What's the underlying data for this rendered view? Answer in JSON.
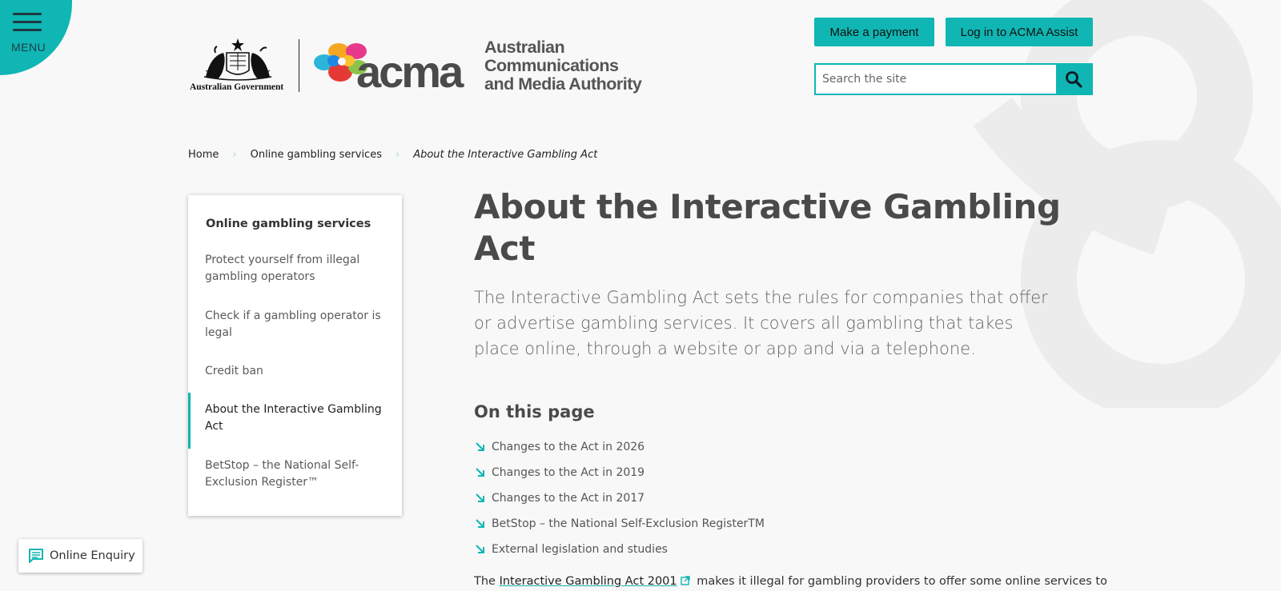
{
  "header": {
    "menu_label": "MENU",
    "gov_label": "Australian Government",
    "acma_word": "acma",
    "acma_fullname_lines": [
      "Australian",
      "Communications",
      "and Media Authority"
    ],
    "payment_label": "Make a payment",
    "login_label": "Log in to ACMA Assist",
    "search_placeholder": "Search the site"
  },
  "breadcrumb": {
    "items": [
      "Home",
      "Online gambling services",
      "About the Interactive Gambling Act"
    ]
  },
  "sidebar": {
    "title": "Online gambling services",
    "items": [
      {
        "label": "Protect yourself from illegal gambling operators"
      },
      {
        "label": "Check if a gambling operator is legal"
      },
      {
        "label": "Credit ban"
      },
      {
        "label": "About the Interactive Gambling Act"
      },
      {
        "label": "BetStop – the National Self-Exclusion Register™"
      }
    ]
  },
  "main": {
    "title": "About the Interactive Gambling Act",
    "intro": "The Interactive Gambling Act sets the rules for companies that offer or advertise gambling services. It covers all gambling that takes place online, through a website or app and via a telephone.",
    "on_this_page_heading": "On this page",
    "on_this_page": [
      "Changes to the Act in 2026",
      "Changes to the Act in 2019",
      "Changes to the Act in 2017",
      "BetStop – the National Self-Exclusion RegisterTM",
      "External legislation and studies"
    ],
    "body_prefix": "The",
    "body_link": "Interactive Gambling Act 2001",
    "body_suffix": "makes it illegal for gambling providers to offer some online services to"
  },
  "enquiry": {
    "label": "Online Enquiry"
  },
  "colors": {
    "accent": "#0fb6b3",
    "text_dark": "#4a4a4a",
    "background": "#f8f8f8"
  }
}
